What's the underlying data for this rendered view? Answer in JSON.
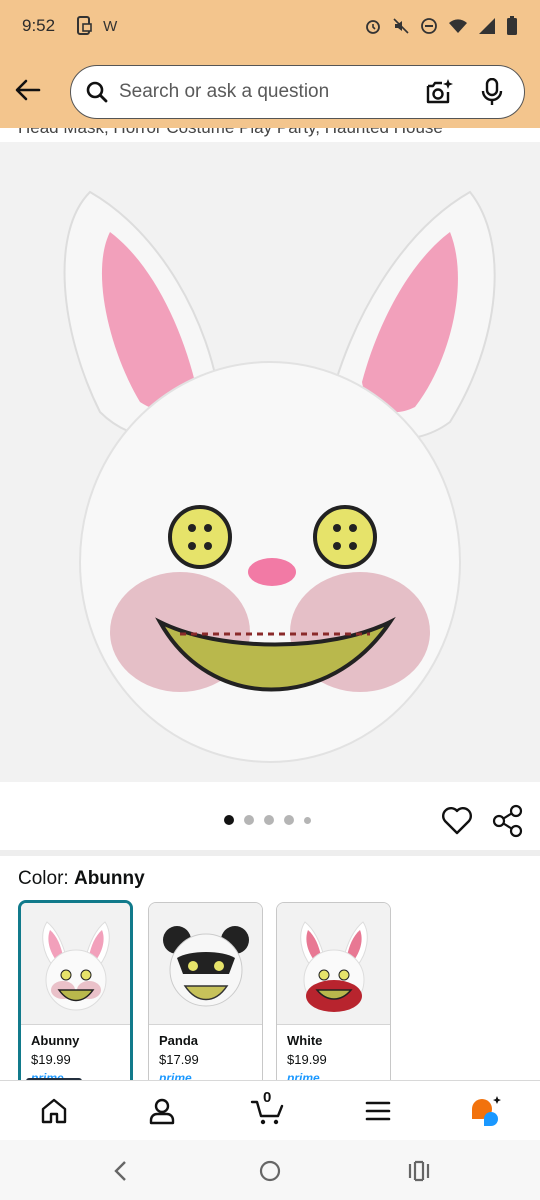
{
  "status_bar": {
    "time": "9:52",
    "carrier_letter": "W",
    "icons": [
      "phone-sync-icon",
      "alarm-icon",
      "mute-icon",
      "do-not-disturb-icon",
      "wifi-icon",
      "signal-icon",
      "battery-icon"
    ]
  },
  "search": {
    "placeholder": "Search or ask a question"
  },
  "product": {
    "title_fragment": "Head Mask, Horror Costume Play Party, Haunted House"
  },
  "carousel": {
    "dot_count": 5,
    "active_index": 0
  },
  "color_selector": {
    "label": "Color: ",
    "selected": "Abunny",
    "options": [
      {
        "name": "Abunny",
        "price": "$19.99",
        "prime": "prime"
      },
      {
        "name": "Panda",
        "price": "$17.99",
        "prime": "prime"
      },
      {
        "name": "White",
        "price": "$19.99",
        "prime": "prime"
      }
    ]
  },
  "bottom_nav": {
    "cart_count": "0",
    "items": [
      "home-icon",
      "account-icon",
      "cart-icon",
      "menu-icon",
      "rufus-icon"
    ]
  },
  "colors": {
    "header_bg": "#f3c58d",
    "selected_border": "#117a8b",
    "prime_blue": "#1a98ff",
    "rufus_orange": "#f2720c",
    "rufus_blue": "#1a98ff"
  }
}
